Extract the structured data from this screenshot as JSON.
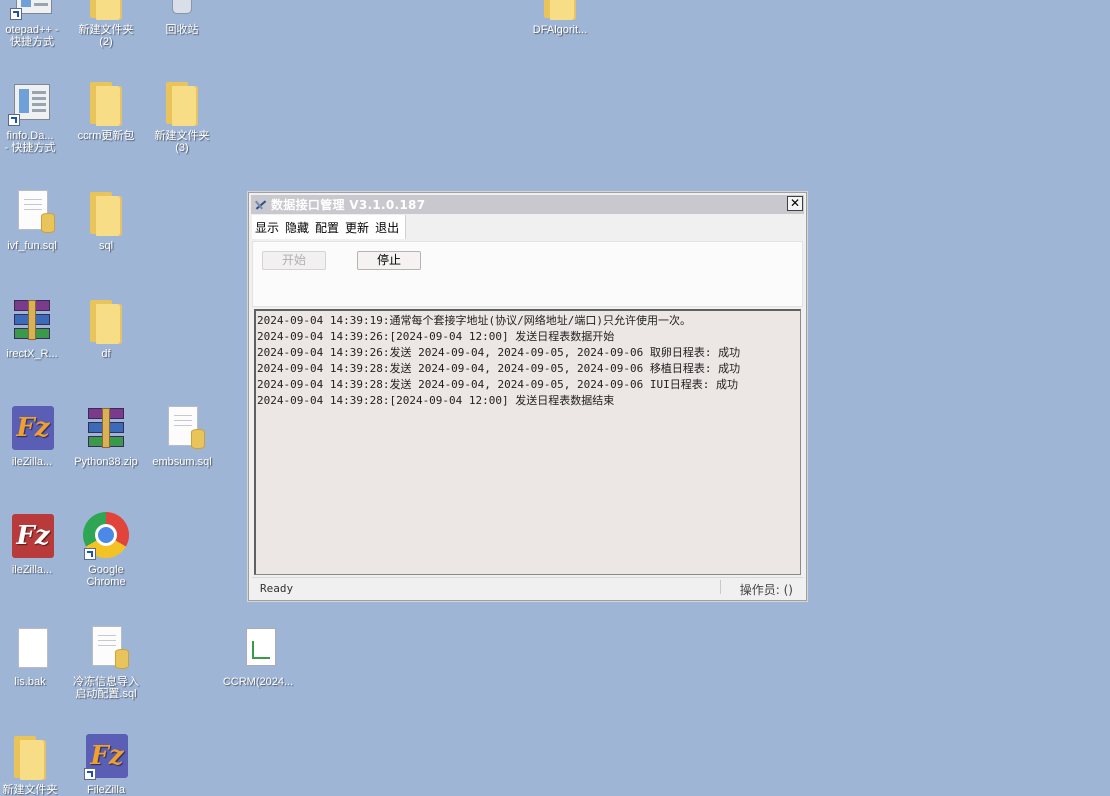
{
  "desktop": {
    "icons": [
      {
        "label": "otepad++ -\n快捷方式"
      },
      {
        "label": "新建文件夹\n(2)"
      },
      {
        "label": "回收站"
      },
      {
        "label": "DFAlgorit..."
      },
      {
        "label": "finfo.Da...\n- 快捷方式"
      },
      {
        "label": "ccrm更新包"
      },
      {
        "label": "新建文件夹\n(3)"
      },
      {
        "label": "ivf_fun.sql"
      },
      {
        "label": "sql"
      },
      {
        "label": "irectX_R..."
      },
      {
        "label": "df"
      },
      {
        "label": "ileZilla..."
      },
      {
        "label": "Python38.zip"
      },
      {
        "label": "embsum.sql"
      },
      {
        "label": "ileZilla..."
      },
      {
        "label": "Google\nChrome"
      },
      {
        "label": "lis.bak"
      },
      {
        "label": "冷冻信息导入\n启动配置.sql"
      },
      {
        "label": "CCRM(2024..."
      },
      {
        "label": "新建文件夹"
      },
      {
        "label": "FileZilla"
      }
    ]
  },
  "window": {
    "title": "数据接口管理 V3.1.0.187",
    "close_label": "✕",
    "menu": [
      "显示",
      "隐藏",
      "配置",
      "更新",
      "退出"
    ],
    "buttons": {
      "start": "开始",
      "stop": "停止"
    },
    "log": [
      "2024-09-04 14:39:19:通常每个套接字地址(协议/网络地址/端口)只允许使用一次。",
      "2024-09-04 14:39:26:[2024-09-04 12:00] 发送日程表数据开始",
      "2024-09-04 14:39:26:发送 2024-09-04, 2024-09-05, 2024-09-06 取卵日程表: 成功",
      "2024-09-04 14:39:28:发送 2024-09-04, 2024-09-05, 2024-09-06 移植日程表: 成功",
      "2024-09-04 14:39:28:发送 2024-09-04, 2024-09-05, 2024-09-06 IUI日程表: 成功",
      "2024-09-04 14:39:28:[2024-09-04 12:00] 发送日程表数据结束"
    ],
    "status": {
      "left": "Ready",
      "right": "操作员: ()"
    }
  },
  "colors": {
    "desktop": "#9fb5d6",
    "titlebar": "#c8c8ce",
    "log_bg": "#ece6e4"
  }
}
